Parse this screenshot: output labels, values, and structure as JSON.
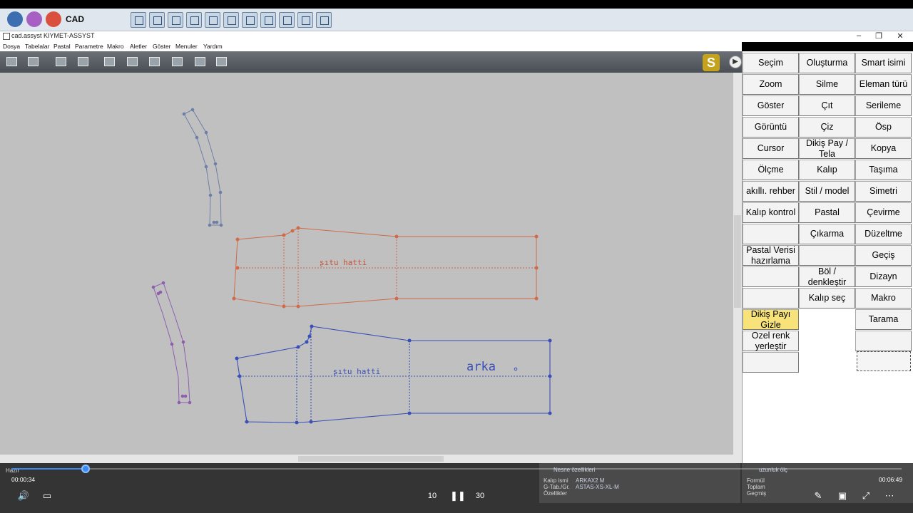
{
  "taskbar": {
    "app_name": "CAD",
    "round_icons": [
      {
        "name": "back-arrow-icon",
        "color": "#3d6fb0"
      },
      {
        "name": "shirt-icon",
        "color": "#a85fc4"
      },
      {
        "name": "tape-icon",
        "color": "#d9503f"
      }
    ],
    "tool_icons": [
      "pattern-tool-1-icon",
      "pattern-tool-2-icon",
      "pattern-tool-3-icon",
      "pattern-tool-4-icon",
      "pattern-tool-5-icon",
      "pattern-tool-6-icon",
      "pattern-tool-7-icon",
      "pattern-tool-8-icon",
      "pattern-tool-9-icon",
      "pattern-tool-10-icon",
      "pattern-tool-11-icon"
    ]
  },
  "window": {
    "title": "cad.assyst  KIYMET-ASSYST",
    "minimize": "‒",
    "maximize": "❐",
    "close": "✕"
  },
  "menu": [
    "Dosya",
    "Tabelalar",
    "Pastal",
    "Parametre",
    "Makro",
    "Aletler",
    "Göster",
    "Menuler",
    "Yardım"
  ],
  "toolbar_icons": [
    "open-folder-icon",
    "save-icon",
    "undo-icon",
    "redo-icon",
    "frame-icon",
    "delete-piece-icon",
    "iron-icon",
    "piece-rect-icon",
    "pencil-icon",
    "layers-icon"
  ],
  "logo_letter": "S",
  "collapse_arrow": "▶",
  "commands": [
    [
      "Seçim",
      "Oluşturma",
      "Smart isimi"
    ],
    [
      "Zoom",
      "Silme",
      "Eleman türü"
    ],
    [
      "Göster",
      "Çıt",
      "Serileme"
    ],
    [
      "Görüntü",
      "Çiz",
      "Ösp"
    ],
    [
      "Cursor",
      "Dikiş Pay / Tela",
      "Kopya"
    ],
    [
      "Ölçme",
      "Kalıp",
      "Taşıma"
    ],
    [
      "akıllı. rehber",
      "Stil / model",
      "Simetri"
    ],
    [
      "Kalıp kontrol",
      "Pastal",
      "Çevirme"
    ],
    [
      "",
      "Çıkarma",
      "Düzeltme"
    ],
    [
      "Pastal Verisi hazırlama",
      "",
      "Geçiş"
    ],
    [
      "",
      "Böl / denkleştir",
      "Dizayn"
    ],
    [
      "",
      "Kalıp seç",
      "Makro"
    ],
    [
      "Dikiş Payı Gizle",
      "",
      "Tarama"
    ],
    [
      "Ozel renk yerleştir",
      "",
      ""
    ],
    [
      "",
      "",
      ""
    ]
  ],
  "highlight_color": "#f7e37a",
  "pattern_labels": {
    "orange_piece": "ʂıtu hatti",
    "blue_piece": "ʂıtu hatti",
    "blue_name": "arka"
  },
  "status": {
    "left": "Hazır",
    "props_title": "Nesne özellikleri",
    "props": [
      {
        "label": "Kalıp ismi",
        "value": "ARKAX2 M"
      },
      {
        "label": "G-Tab./Gr.",
        "value": "ASTAS-XS-XL-M"
      },
      {
        "label": "Özellikler",
        "value": ""
      }
    ],
    "olc_title": "uzunluk ölç",
    "olc_rows": [
      "Formül",
      "Toplam",
      "Geçmiş"
    ]
  },
  "video": {
    "elapsed": "00:00:34",
    "duration": "00:06:49",
    "progress": 0.083,
    "skip_back": "10",
    "skip_fwd": "30"
  }
}
